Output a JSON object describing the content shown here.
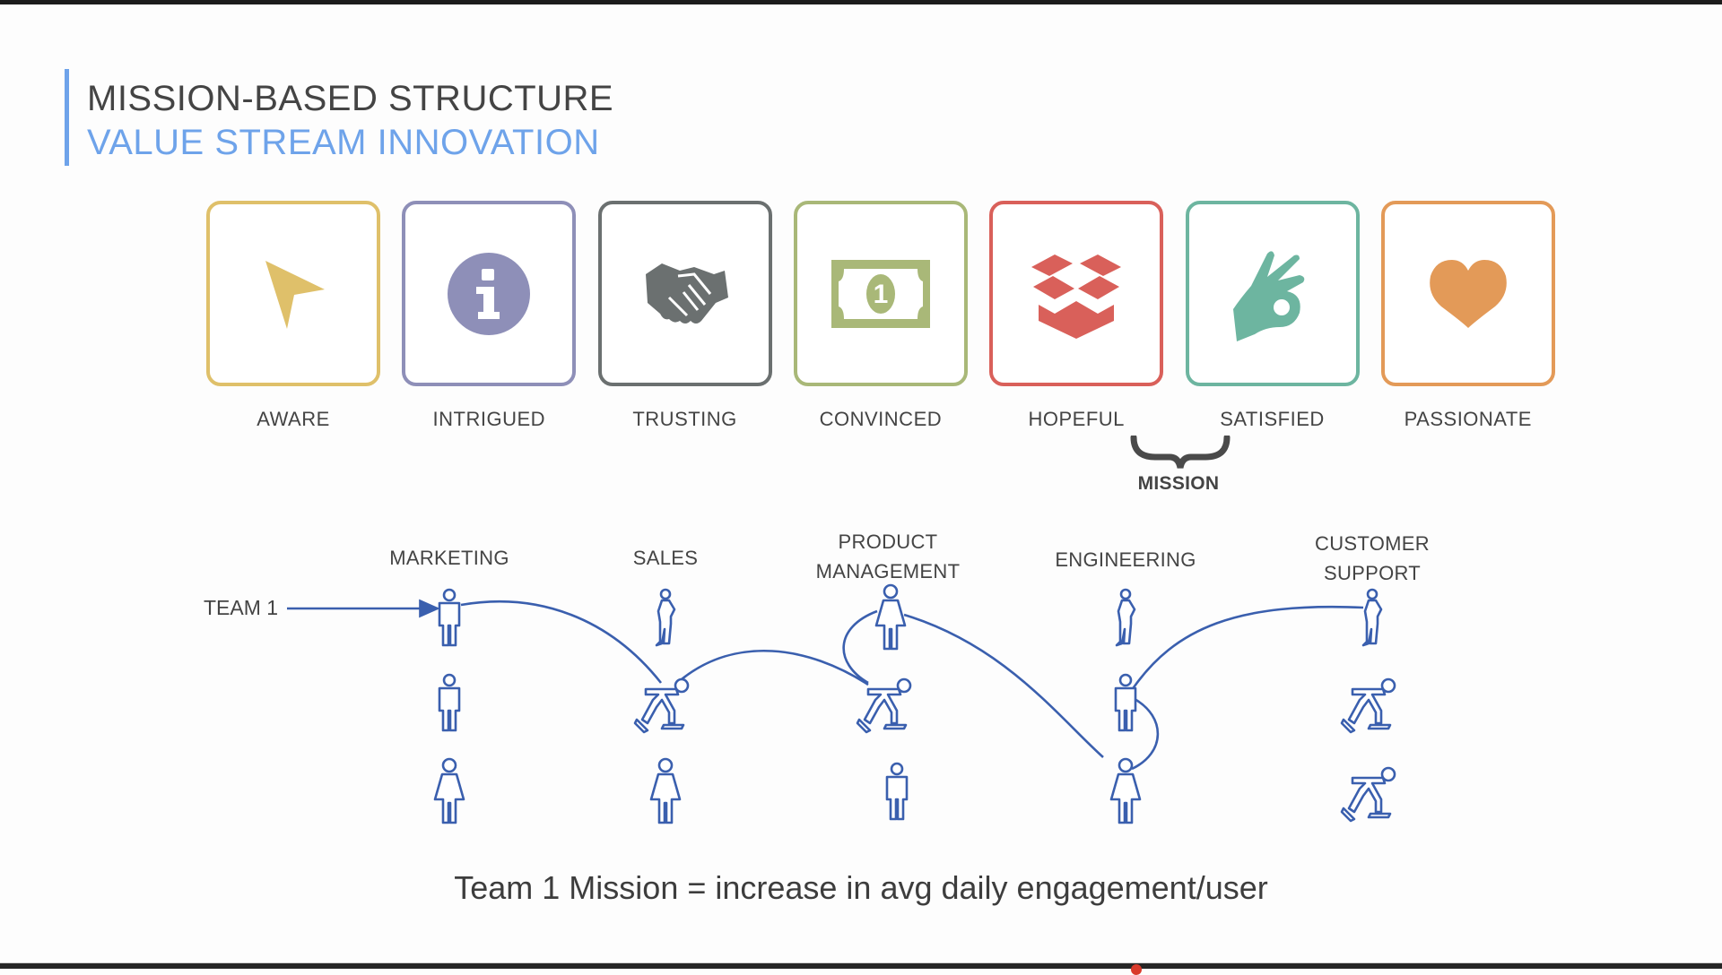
{
  "header": {
    "title": "MISSION-BASED STRUCTURE",
    "subtitle": "VALUE STREAM INNOVATION",
    "accent_color": "#6ea3ea"
  },
  "journey_stages": [
    {
      "label": "AWARE",
      "icon": "cursor-arrow-icon",
      "color": "#dfc06a"
    },
    {
      "label": "INTRIGUED",
      "icon": "info-icon",
      "color": "#8e8fb8"
    },
    {
      "label": "TRUSTING",
      "icon": "handshake-icon",
      "color": "#6b7070"
    },
    {
      "label": "CONVINCED",
      "icon": "dollar-bill-icon",
      "color": "#a9b878"
    },
    {
      "label": "HOPEFUL",
      "icon": "open-box-icon",
      "color": "#d9605a"
    },
    {
      "label": "SATISFIED",
      "icon": "ok-hand-icon",
      "color": "#6db5a0"
    },
    {
      "label": "PASSIONATE",
      "icon": "heart-icon",
      "color": "#e39a58"
    }
  ],
  "mission_marker": {
    "label": "MISSION",
    "spans": [
      "HOPEFUL",
      "SATISFIED"
    ]
  },
  "team": {
    "label": "TEAM 1",
    "line_color": "#3a5fae"
  },
  "departments": [
    {
      "label_lines": [
        "MARKETING"
      ],
      "people": [
        "man",
        "man",
        "woman"
      ]
    },
    {
      "label_lines": [
        "SALES"
      ],
      "people": [
        "standing",
        "skater",
        "woman"
      ]
    },
    {
      "label_lines": [
        "PRODUCT",
        "MANAGEMENT"
      ],
      "people": [
        "woman",
        "skater",
        "man"
      ]
    },
    {
      "label_lines": [
        "ENGINEERING"
      ],
      "people": [
        "standing",
        "man",
        "woman"
      ]
    },
    {
      "label_lines": [
        "CUSTOMER",
        "SUPPORT"
      ],
      "people": [
        "standing",
        "skater",
        "skater"
      ]
    }
  ],
  "footer": {
    "text": "Team 1 Mission = increase in avg daily engagement/user"
  },
  "player": {
    "progress_percent": 66
  }
}
